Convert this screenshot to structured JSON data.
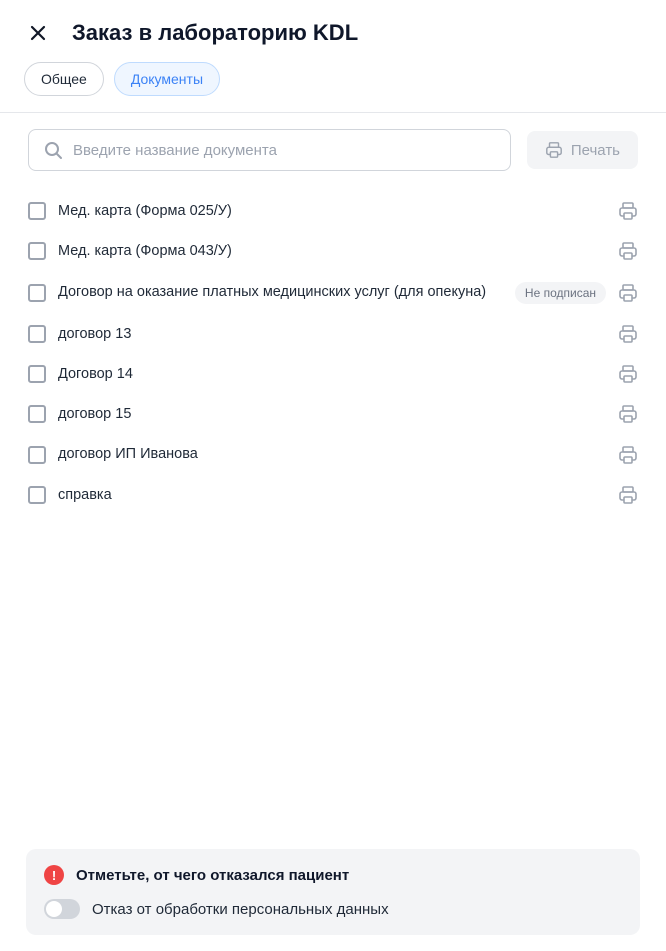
{
  "header": {
    "title": "Заказ в лабораторию KDL"
  },
  "tabs": [
    {
      "label": "Общее",
      "active": false
    },
    {
      "label": "Документы",
      "active": true
    }
  ],
  "search": {
    "placeholder": "Введите название документа"
  },
  "print_button": {
    "label": "Печать"
  },
  "documents": [
    {
      "label": "Мед. карта (Форма 025/У)",
      "badge": null
    },
    {
      "label": "Мед. карта (Форма 043/У)",
      "badge": null
    },
    {
      "label": "Договор на оказание платных медицинских услуг (для опекуна)",
      "badge": "Не подписан"
    },
    {
      "label": "договор 13",
      "badge": null
    },
    {
      "label": "Договор 14",
      "badge": null
    },
    {
      "label": "договор 15",
      "badge": null
    },
    {
      "label": "договор ИП Иванова",
      "badge": null
    },
    {
      "label": "справка",
      "badge": null
    }
  ],
  "footer": {
    "title": "Отметьте, от чего отказался пациент",
    "toggle_label": "Отказ от обработки персональных данных"
  }
}
